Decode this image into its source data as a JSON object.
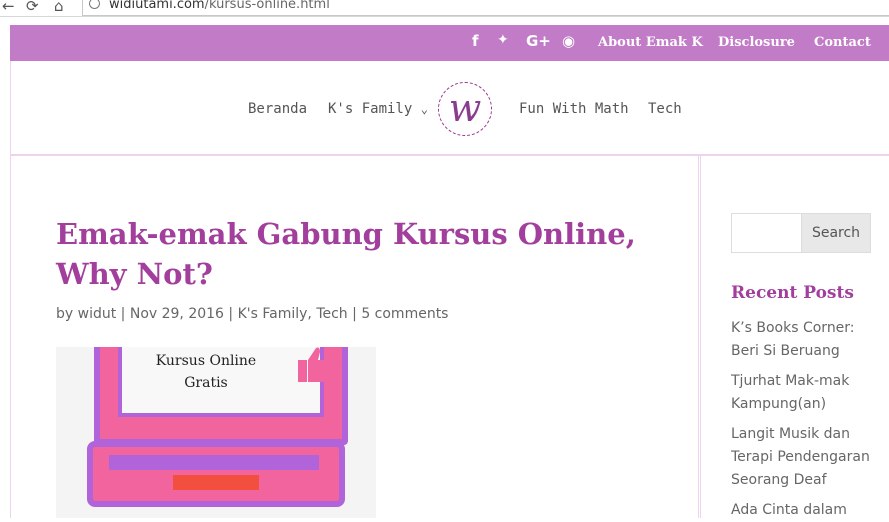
{
  "browser": {
    "back_glyph": "←",
    "reload_glyph": "⟳",
    "home_glyph": "⌂",
    "url_domain": "widiutami.com",
    "url_path": "/kursus-online.html"
  },
  "topbar": {
    "background": "#c17bc7",
    "social": {
      "facebook": "f",
      "twitter": "✦",
      "googleplus": "G+",
      "rss": "◉"
    },
    "links": [
      "About Emak K",
      "Disclosure",
      "Contact"
    ]
  },
  "menu": {
    "items": [
      "Beranda",
      "K's Family",
      "Fun With Math",
      "Tech"
    ],
    "dropdown_glyph": "⌄",
    "logo_letter": "w"
  },
  "post": {
    "title": "Emak-emak Gabung Kursus Online, Why Not?",
    "meta": {
      "by": "by",
      "author": "widut",
      "date": "Nov 29, 2016",
      "categories": [
        "K's Family",
        "Tech"
      ],
      "comments": "5 comments",
      "sep": "|",
      "comma": ","
    },
    "image_text": [
      "Kursus Online",
      "Gratis"
    ]
  },
  "sidebar": {
    "search_button": "Search",
    "search_placeholder": "",
    "recent_title": "Recent Posts",
    "recent_posts": [
      [
        "K’s Books Corner:",
        "Beri Si Beruang"
      ],
      [
        "Tjurhat Mak-mak",
        "Kampung(an)"
      ],
      [
        "Langit Musik dan",
        "Terapi Pendengaran",
        "Seorang Deaf"
      ],
      [
        "Ada Cinta dalam"
      ]
    ]
  },
  "colors": {
    "accent_purple": "#a23e9c",
    "topbar_purple": "#c17bc7",
    "laptop_pink": "#f2649d",
    "laptop_violet": "#b163d9"
  }
}
